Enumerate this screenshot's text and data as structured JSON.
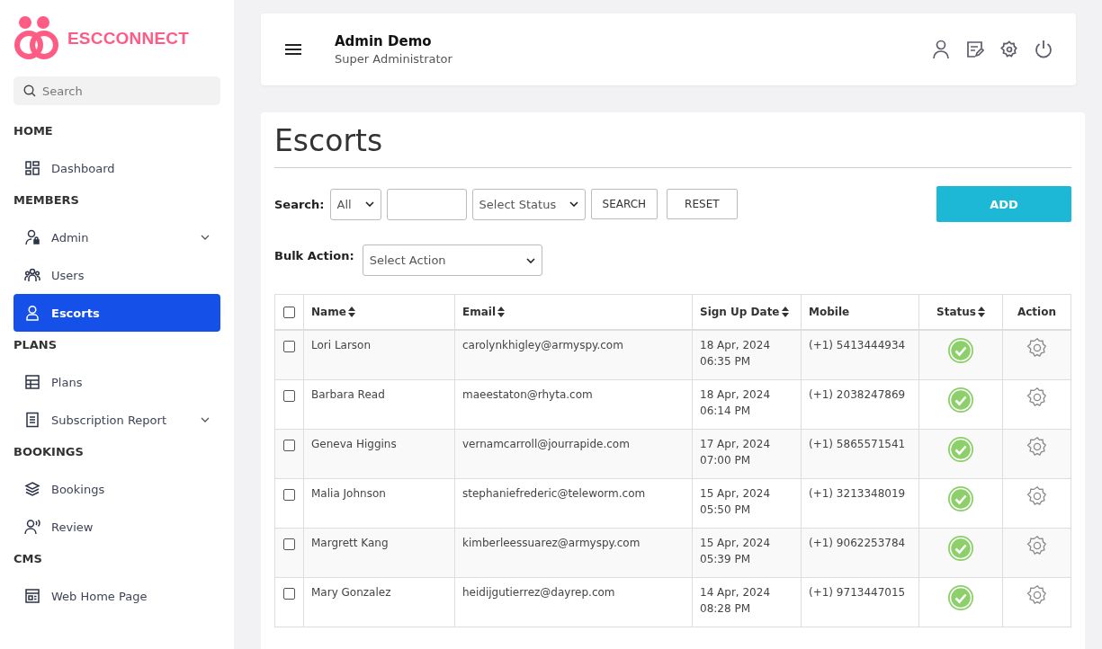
{
  "brand": {
    "name": "ESCCONNECT"
  },
  "sidebar": {
    "search": {
      "placeholder": "Search"
    },
    "sections": [
      {
        "heading": "HOME",
        "items": [
          {
            "label": "Dashboard",
            "kind": "dashboard",
            "selected": false,
            "expandable": false
          }
        ]
      },
      {
        "heading": "MEMBERS",
        "items": [
          {
            "label": "Admin",
            "kind": "admin",
            "selected": false,
            "expandable": true
          },
          {
            "label": "Users",
            "kind": "users",
            "selected": false,
            "expandable": false
          },
          {
            "label": "Escorts",
            "kind": "person",
            "selected": true,
            "expandable": false
          }
        ]
      },
      {
        "heading": "PLANS",
        "items": [
          {
            "label": "Plans",
            "kind": "table",
            "selected": false,
            "expandable": false
          },
          {
            "label": "Subscription Report",
            "kind": "report",
            "selected": false,
            "expandable": true
          }
        ]
      },
      {
        "heading": "BOOKINGS",
        "items": [
          {
            "label": "Bookings",
            "kind": "layers",
            "selected": false,
            "expandable": false
          },
          {
            "label": "Review",
            "kind": "review",
            "selected": false,
            "expandable": false
          }
        ]
      },
      {
        "heading": "CMS",
        "items": [
          {
            "label": "Web Home Page",
            "kind": "page",
            "selected": false,
            "expandable": false
          }
        ]
      }
    ]
  },
  "header": {
    "user_name": "Admin Demo",
    "user_role": "Super Administrator"
  },
  "page": {
    "title": "Escorts",
    "filters": {
      "search_label": "Search:",
      "field_select": "All",
      "status_select": "Select Status",
      "search_button": "SEARCH",
      "reset_button": "RESET",
      "add_button": "ADD"
    },
    "bulk": {
      "label": "Bulk Action:",
      "select": "Select Action"
    },
    "table": {
      "select_all_checked": false,
      "columns": [
        {
          "label": "Name",
          "sortable": true
        },
        {
          "label": "Email",
          "sortable": true
        },
        {
          "label": "Sign Up Date",
          "sortable": true
        },
        {
          "label": "Mobile",
          "sortable": false
        },
        {
          "label": "Status",
          "sortable": true
        },
        {
          "label": "Action",
          "sortable": false
        }
      ],
      "rows": [
        {
          "checked": false,
          "name": "Lori Larson",
          "email": "carolynkhigley@armyspy.com",
          "date": "18 Apr, 2024",
          "time": "06:35 PM",
          "mobile": "(+1) 5413444934",
          "active": true
        },
        {
          "checked": false,
          "name": "Barbara Read",
          "email": "maeestaton@rhyta.com",
          "date": "18 Apr, 2024",
          "time": "06:14 PM",
          "mobile": "(+1) 2038247869",
          "active": true
        },
        {
          "checked": false,
          "name": "Geneva Higgins",
          "email": "vernamcarroll@jourrapide.com",
          "date": "17 Apr, 2024",
          "time": "07:00 PM",
          "mobile": "(+1) 5865571541",
          "active": true
        },
        {
          "checked": false,
          "name": "Malia Johnson",
          "email": "stephaniefrederic@teleworm.com",
          "date": "15 Apr, 2024",
          "time": "05:50 PM",
          "mobile": "(+1) 3213348019",
          "active": true
        },
        {
          "checked": false,
          "name": "Margrett Kang",
          "email": "kimberleessuarez@armyspy.com",
          "date": "15 Apr, 2024",
          "time": "05:39 PM",
          "mobile": "(+1) 9062253784",
          "active": true
        },
        {
          "checked": false,
          "name": "Mary Gonzalez",
          "email": "heidijgutierrez@dayrep.com",
          "date": "14 Apr, 2024",
          "time": "08:28 PM",
          "mobile": "(+1) 9713447015",
          "active": true
        }
      ]
    }
  }
}
